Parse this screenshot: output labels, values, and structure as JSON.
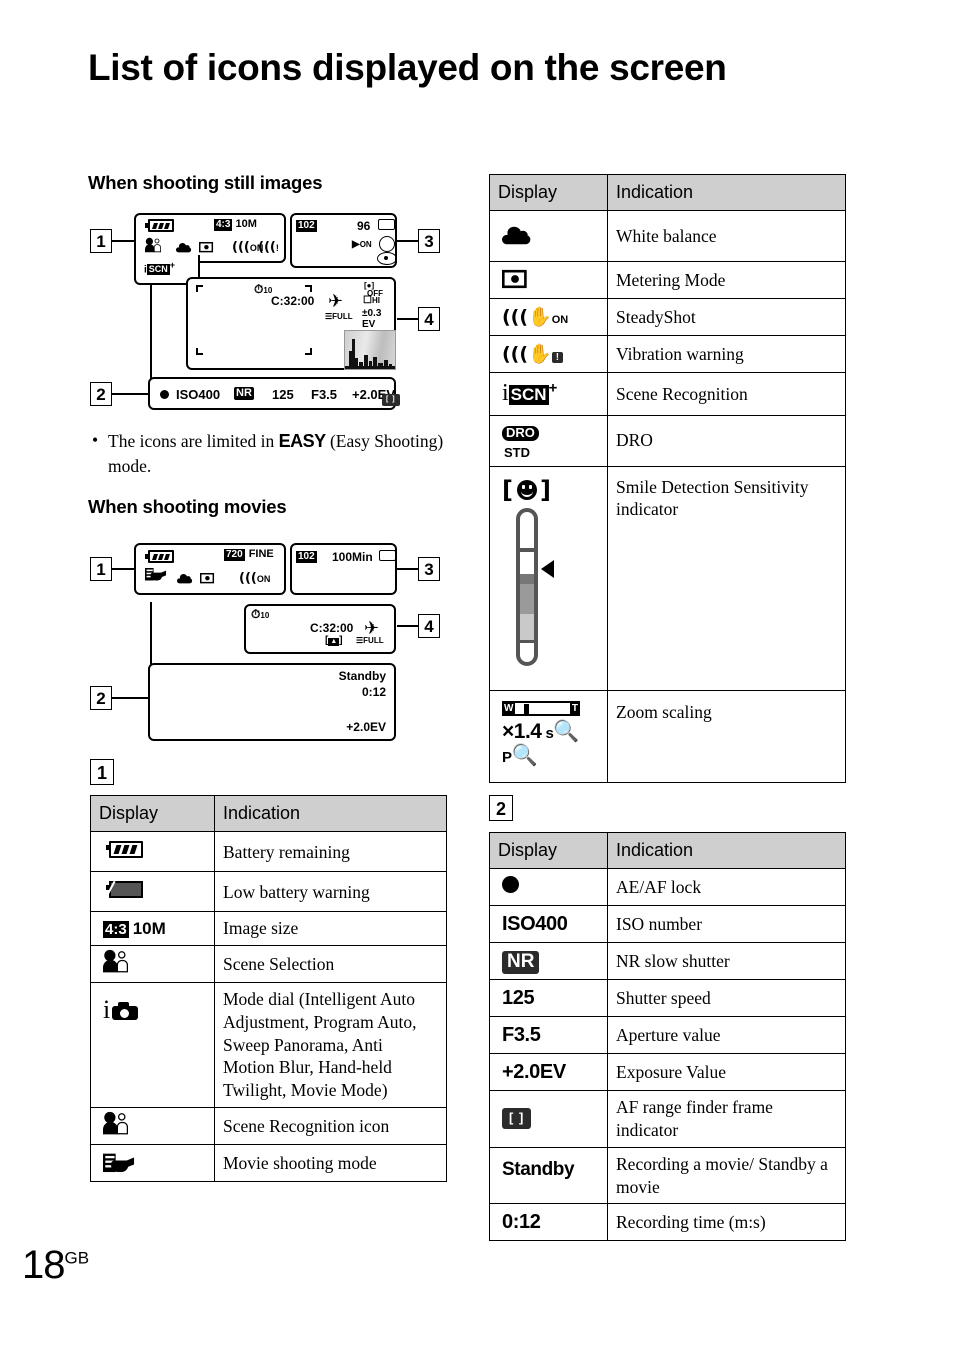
{
  "page": {
    "title": "List of icons displayed on the screen",
    "folio_number": "18",
    "folio_suffix": "GB"
  },
  "sections": {
    "still_heading": "When shooting still images",
    "movies_heading": "When shooting movies",
    "note_before": "The icons are limited in",
    "note_easy": "EASY",
    "note_after": "(Easy Shooting) mode.",
    "bullet": "•"
  },
  "callouts": {
    "still": {
      "one": "1",
      "two": "2",
      "three": "3",
      "four": "4"
    },
    "movie": {
      "one": "1",
      "two": "2",
      "three": "3",
      "four": "4"
    },
    "table1_label": "1",
    "table2_label": "2"
  },
  "still_screen": {
    "image_size_ratio": "4:3",
    "image_size_value": "10M",
    "folder": "102",
    "shots_remaining": "96",
    "flash_on_label": "ON",
    "scene_recognition_i": "i",
    "scene_recognition_scn": "SCN",
    "scene_recognition_plus": "+",
    "steadyshot_on": "ON",
    "selftimer": "10",
    "clock": "C:32:00",
    "full_label": "FULL",
    "burst_hi": "HI",
    "ev_value": "±0.3",
    "ev_unit": "EV",
    "off_label": "OFF",
    "status_row": {
      "ae_af": "●",
      "iso": "ISO400",
      "nr": "NR",
      "shutter": "125",
      "aperture": "F3.5",
      "ev": "+2.0EV",
      "af_frame": "[ ]"
    }
  },
  "movie_screen": {
    "quality_badge": "720",
    "quality_label": "FINE",
    "folder": "102",
    "rec_capacity": "100Min",
    "steadyshot_on": "ON",
    "selftimer": "10",
    "clock": "C:32:00",
    "af_frame": "[ ]",
    "full_label": "FULL",
    "standby": "Standby",
    "rec_time": "0:12",
    "ev": "+2.0EV"
  },
  "table1": {
    "headers": [
      "Display",
      "Indication"
    ],
    "rows": [
      {
        "display_kind": "battery-full",
        "display_text": "",
        "indication": "Battery remaining"
      },
      {
        "display_kind": "battery-low",
        "display_text": "",
        "indication": "Low battery warning"
      },
      {
        "display_kind": "image-size",
        "display_text": "4:3 10M",
        "indication": "Image size"
      },
      {
        "display_kind": "person",
        "display_text": "",
        "indication": "Scene Selection"
      },
      {
        "display_kind": "mode-dial",
        "display_text": "i",
        "indication": "Mode dial (Intelligent Auto Adjustment, Program Auto, Sweep Panorama, Anti Motion Blur, Hand-held Twilight, Movie Mode)"
      },
      {
        "display_kind": "person",
        "display_text": "",
        "indication": "Scene Recognition icon"
      },
      {
        "display_kind": "movie-camera",
        "display_text": "",
        "indication": "Movie shooting mode"
      }
    ]
  },
  "table_right_top": {
    "headers": [
      "Display",
      "Indication"
    ],
    "rows": [
      {
        "display_kind": "cloud",
        "display_text": "",
        "indication": "White balance"
      },
      {
        "display_kind": "metering",
        "display_text": "",
        "indication": "Metering Mode"
      },
      {
        "display_kind": "steadyshot",
        "display_text": "ON",
        "indication": "SteadyShot"
      },
      {
        "display_kind": "vibration",
        "display_text": "!",
        "indication": "Vibration warning"
      },
      {
        "display_kind": "scene-recog",
        "display_text": "i SCN +",
        "indication": "Scene Recognition"
      },
      {
        "display_kind": "dro",
        "display_text": "DRO STD",
        "indication": "DRO"
      },
      {
        "display_kind": "smile-bar",
        "display_text": "[ ☺ ]",
        "indication": "Smile Detection Sensitivity indicator"
      },
      {
        "display_kind": "zoom-scaling",
        "display_text": "W T ×1.4 s P",
        "indication": "Zoom scaling"
      }
    ],
    "dro_top": "DRO",
    "dro_bottom": "STD",
    "zoom_w": "W",
    "zoom_t": "T",
    "zoom_factor": "×1.4",
    "zoom_s": "s",
    "zoom_p": "P"
  },
  "table2": {
    "headers": [
      "Display",
      "Indication"
    ],
    "rows": [
      {
        "display_kind": "dot",
        "display_text": "●",
        "indication": "AE/AF lock"
      },
      {
        "display_kind": "text",
        "display_text": "ISO400",
        "indication": "ISO number"
      },
      {
        "display_kind": "tag",
        "display_text": "NR",
        "indication": "NR slow shutter"
      },
      {
        "display_kind": "text",
        "display_text": "125",
        "indication": "Shutter speed"
      },
      {
        "display_kind": "text",
        "display_text": "F3.5",
        "indication": "Aperture value"
      },
      {
        "display_kind": "text",
        "display_text": "+2.0EV",
        "indication": "Exposure Value"
      },
      {
        "display_kind": "tag-sm",
        "display_text": "[ ]",
        "indication": "AF range finder frame indicator"
      },
      {
        "display_kind": "text",
        "display_text": "Standby",
        "indication": "Recording a movie/ Standby a movie"
      },
      {
        "display_kind": "text",
        "display_text": "0:12",
        "indication": "Recording time (m:s)"
      }
    ]
  },
  "colors": {
    "header_fill": "#cfcfcf",
    "rule": "#000000",
    "tag_fill": "#2b2b2b"
  }
}
